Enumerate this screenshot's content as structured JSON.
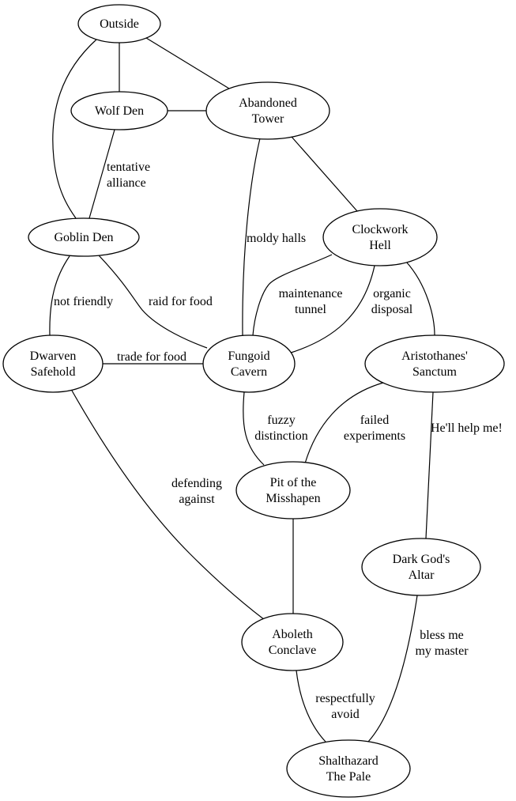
{
  "graph": {
    "type": "undirected",
    "nodes": [
      {
        "id": "outside",
        "lines": [
          "Outside"
        ]
      },
      {
        "id": "wolf-den",
        "lines": [
          "Wolf Den"
        ]
      },
      {
        "id": "abandoned-tower",
        "lines": [
          "Abandoned",
          "Tower"
        ]
      },
      {
        "id": "goblin-den",
        "lines": [
          "Goblin Den"
        ]
      },
      {
        "id": "clockwork-hell",
        "lines": [
          "Clockwork",
          "Hell"
        ]
      },
      {
        "id": "dwarven-safehold",
        "lines": [
          "Dwarven",
          "Safehold"
        ]
      },
      {
        "id": "fungoid-cavern",
        "lines": [
          "Fungoid",
          "Cavern"
        ]
      },
      {
        "id": "aristothanes-sanctum",
        "lines": [
          "Aristothanes'",
          "Sanctum"
        ]
      },
      {
        "id": "pit-of-the-misshapen",
        "lines": [
          "Pit of the",
          "Misshapen"
        ]
      },
      {
        "id": "dark-gods-altar",
        "lines": [
          "Dark God's",
          "Altar"
        ]
      },
      {
        "id": "aboleth-conclave",
        "lines": [
          "Aboleth",
          "Conclave"
        ]
      },
      {
        "id": "shalthazard-the-pale",
        "lines": [
          "Shalthazard",
          "The Pale"
        ]
      }
    ],
    "edges": [
      {
        "from": "outside",
        "to": "wolf-den",
        "label": []
      },
      {
        "from": "outside",
        "to": "abandoned-tower",
        "label": []
      },
      {
        "from": "outside",
        "to": "goblin-den",
        "label": []
      },
      {
        "from": "wolf-den",
        "to": "abandoned-tower",
        "label": []
      },
      {
        "from": "wolf-den",
        "to": "goblin-den",
        "label": [
          "tentative",
          "alliance"
        ]
      },
      {
        "from": "abandoned-tower",
        "to": "fungoid-cavern",
        "label": [
          "moldy halls"
        ]
      },
      {
        "from": "abandoned-tower",
        "to": "clockwork-hell",
        "label": []
      },
      {
        "from": "goblin-den",
        "to": "dwarven-safehold",
        "label": [
          "not friendly"
        ]
      },
      {
        "from": "goblin-den",
        "to": "fungoid-cavern",
        "label": [
          "raid for food"
        ]
      },
      {
        "from": "clockwork-hell",
        "to": "fungoid-cavern",
        "label": [
          "maintenance",
          "tunnel"
        ]
      },
      {
        "from": "clockwork-hell",
        "to": "fungoid-cavern",
        "label": [
          "organic",
          "disposal"
        ]
      },
      {
        "from": "clockwork-hell",
        "to": "aristothanes-sanctum",
        "label": []
      },
      {
        "from": "dwarven-safehold",
        "to": "fungoid-cavern",
        "label": [
          "trade for food"
        ]
      },
      {
        "from": "dwarven-safehold",
        "to": "aboleth-conclave",
        "label": [
          "defending",
          "against"
        ]
      },
      {
        "from": "fungoid-cavern",
        "to": "pit-of-the-misshapen",
        "label": [
          "fuzzy",
          "distinction"
        ]
      },
      {
        "from": "aristothanes-sanctum",
        "to": "pit-of-the-misshapen",
        "label": [
          "failed",
          "experiments"
        ]
      },
      {
        "from": "aristothanes-sanctum",
        "to": "dark-gods-altar",
        "label": [
          "He'll help me!"
        ]
      },
      {
        "from": "pit-of-the-misshapen",
        "to": "aboleth-conclave",
        "label": []
      },
      {
        "from": "aboleth-conclave",
        "to": "shalthazard-the-pale",
        "label": [
          "respectfully",
          "avoid"
        ]
      },
      {
        "from": "dark-gods-altar",
        "to": "shalthazard-the-pale",
        "label": [
          "bless me",
          "my master"
        ]
      }
    ]
  }
}
